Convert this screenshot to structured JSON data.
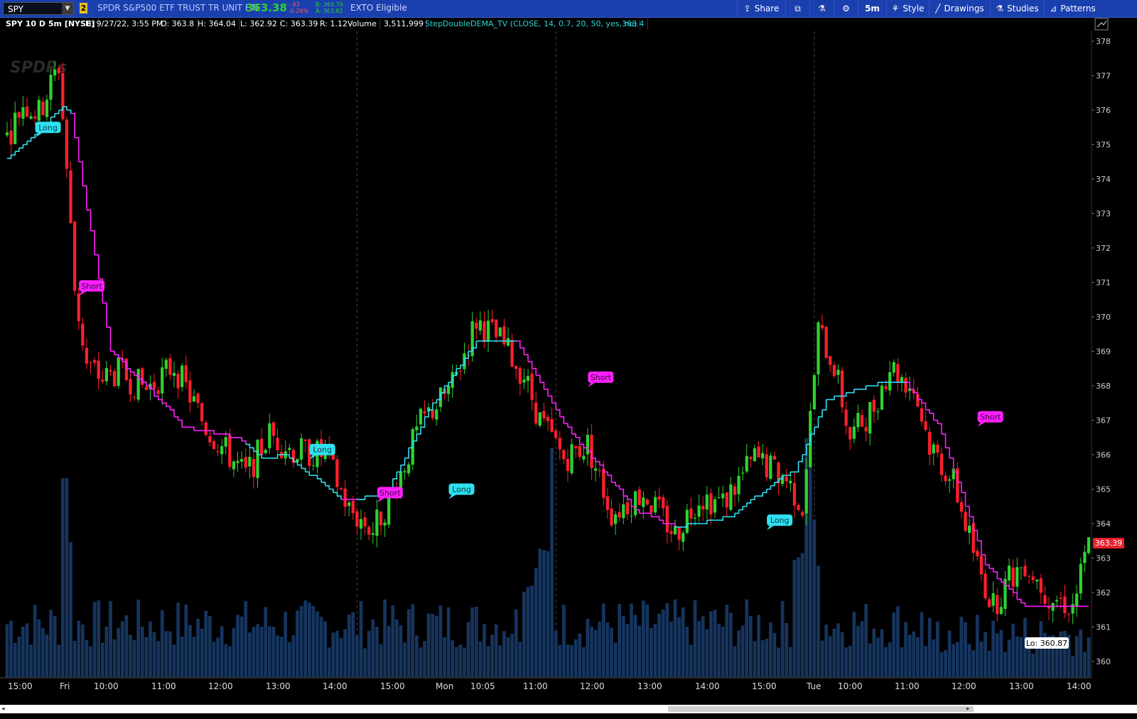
{
  "toolbar": {
    "symbol": "SPY",
    "link_badge": "2",
    "description": "SPDR S&P500 ETF TRUST TR UNIT ETF",
    "last_price": "363.38",
    "net_change": "-.93",
    "pct_change": "-0.26%",
    "bid": "B: 363.79",
    "ask": "A: 363.82",
    "exto": "EXTO Eligible",
    "buttons": {
      "share": "Share",
      "timeframe": "5m",
      "style": "Style",
      "drawings": "Drawings",
      "studies": "Studies",
      "patterns": "Patterns"
    }
  },
  "infobar": {
    "title": "SPY 10 D 5m [NYSE]",
    "date": "D: 9/27/22, 3:55 PM",
    "open": "O: 363.8",
    "high": "H: 364.04",
    "low": "L: 362.92",
    "close": "C: 363.39",
    "range": "R: 1.12",
    "volume_label": "Volume",
    "volume_value": "3,511,999",
    "study": "StepDoubleDEMA_TV (CLOSE, 14, 0.7, 20, 50, yes, no)",
    "study_value": "363.4"
  },
  "watermark": "SPDRs",
  "colors": {
    "up": "#2fd12f",
    "down": "#ff1f2d",
    "long_line": "#2ee0f0",
    "short_line": "#ff20ff",
    "volume": "#16355f",
    "toolbar": "#1a3fae",
    "price_tag": "#e8202e"
  },
  "chart_data": {
    "type": "candlestick",
    "timeframe": "5m",
    "y_ticks": [
      360,
      361,
      362,
      363,
      364,
      365,
      366,
      367,
      368,
      369,
      370,
      371,
      372,
      373,
      374,
      375,
      376,
      377,
      378
    ],
    "ylim": [
      359.5,
      378.5
    ],
    "x_ticks": [
      "15:00",
      "Fri",
      "10:00",
      "11:00",
      "12:00",
      "13:00",
      "14:00",
      "15:00",
      "Mon",
      "10:05",
      "11:00",
      "12:00",
      "13:00",
      "14:00",
      "15:00",
      "Tue",
      "10:00",
      "11:00",
      "12:00",
      "13:00",
      "14:00"
    ],
    "current_price": "363.39",
    "low_label": "Lo: 360.87",
    "signals": [
      {
        "type": "Long",
        "price": 375.5
      },
      {
        "type": "Short",
        "price": 370.9
      },
      {
        "type": "Long",
        "price": 366.15
      },
      {
        "type": "Short",
        "price": 364.9
      },
      {
        "type": "Long",
        "price": 365.0
      },
      {
        "type": "Short",
        "price": 368.25
      },
      {
        "type": "Long",
        "price": 364.1
      },
      {
        "type": "Short",
        "price": 367.1
      }
    ],
    "step_line_anchors": [
      {
        "bar": 0,
        "price": 374.6
      },
      {
        "bar": 8,
        "price": 375.4
      },
      {
        "bar": 14,
        "price": 376.1
      },
      {
        "bar": 16,
        "price": 375.9
      },
      {
        "bar": 26,
        "price": 369.0
      },
      {
        "bar": 40,
        "price": 367.4
      },
      {
        "bar": 44,
        "price": 366.8
      },
      {
        "bar": 58,
        "price": 366.5
      },
      {
        "bar": 64,
        "price": 365.85
      },
      {
        "bar": 70,
        "price": 366.0
      },
      {
        "bar": 84,
        "price": 364.7
      },
      {
        "bar": 95,
        "price": 364.8
      },
      {
        "bar": 106,
        "price": 367.3
      },
      {
        "bar": 118,
        "price": 369.3
      },
      {
        "bar": 128,
        "price": 369.25
      },
      {
        "bar": 140,
        "price": 366.9
      },
      {
        "bar": 158,
        "price": 364.4
      },
      {
        "bar": 168,
        "price": 363.9
      },
      {
        "bar": 182,
        "price": 364.2
      },
      {
        "bar": 194,
        "price": 365.3
      },
      {
        "bar": 198,
        "price": 365.5
      },
      {
        "bar": 206,
        "price": 367.6
      },
      {
        "bar": 220,
        "price": 368.1
      },
      {
        "bar": 226,
        "price": 368.05
      },
      {
        "bar": 234,
        "price": 366.9
      },
      {
        "bar": 246,
        "price": 362.8
      },
      {
        "bar": 256,
        "price": 361.6
      },
      {
        "bar": 272,
        "price": 361.6
      }
    ],
    "long_segments": [
      [
        0,
        16
      ],
      [
        60,
        84
      ],
      [
        88,
        128
      ],
      [
        168,
        226
      ]
    ],
    "price_path": [
      {
        "bar": 0,
        "price": 375.2
      },
      {
        "bar": 4,
        "price": 376.2
      },
      {
        "bar": 8,
        "price": 375.9
      },
      {
        "bar": 13,
        "price": 377.3
      },
      {
        "bar": 15,
        "price": 374.3
      },
      {
        "bar": 17,
        "price": 370.8
      },
      {
        "bar": 20,
        "price": 368.6
      },
      {
        "bar": 24,
        "price": 368.2
      },
      {
        "bar": 28,
        "price": 368.4
      },
      {
        "bar": 35,
        "price": 367.9
      },
      {
        "bar": 42,
        "price": 368.6
      },
      {
        "bar": 50,
        "price": 366.8
      },
      {
        "bar": 60,
        "price": 365.4
      },
      {
        "bar": 66,
        "price": 366.6
      },
      {
        "bar": 72,
        "price": 366.1
      },
      {
        "bar": 80,
        "price": 366.0
      },
      {
        "bar": 86,
        "price": 364.4
      },
      {
        "bar": 92,
        "price": 363.8
      },
      {
        "bar": 97,
        "price": 364.9
      },
      {
        "bar": 104,
        "price": 366.9
      },
      {
        "bar": 112,
        "price": 368.0
      },
      {
        "bar": 118,
        "price": 369.9
      },
      {
        "bar": 124,
        "price": 369.3
      },
      {
        "bar": 130,
        "price": 368.3
      },
      {
        "bar": 134,
        "price": 367.0
      },
      {
        "bar": 140,
        "price": 365.9
      },
      {
        "bar": 146,
        "price": 366.3
      },
      {
        "bar": 152,
        "price": 364.3
      },
      {
        "bar": 160,
        "price": 364.9
      },
      {
        "bar": 168,
        "price": 363.7
      },
      {
        "bar": 174,
        "price": 364.8
      },
      {
        "bar": 180,
        "price": 364.6
      },
      {
        "bar": 188,
        "price": 365.9
      },
      {
        "bar": 196,
        "price": 365.3
      },
      {
        "bar": 200,
        "price": 364.5
      },
      {
        "bar": 204,
        "price": 369.6
      },
      {
        "bar": 208,
        "price": 368.6
      },
      {
        "bar": 212,
        "price": 366.5
      },
      {
        "bar": 218,
        "price": 367.4
      },
      {
        "bar": 222,
        "price": 368.6
      },
      {
        "bar": 228,
        "price": 367.9
      },
      {
        "bar": 232,
        "price": 366.3
      },
      {
        "bar": 238,
        "price": 365.2
      },
      {
        "bar": 244,
        "price": 362.8
      },
      {
        "bar": 248,
        "price": 361.6
      },
      {
        "bar": 252,
        "price": 362.4
      },
      {
        "bar": 256,
        "price": 362.9
      },
      {
        "bar": 262,
        "price": 361.9
      },
      {
        "bar": 268,
        "price": 361.6
      },
      {
        "bar": 272,
        "price": 363.4
      }
    ],
    "n_bars": 273
  }
}
